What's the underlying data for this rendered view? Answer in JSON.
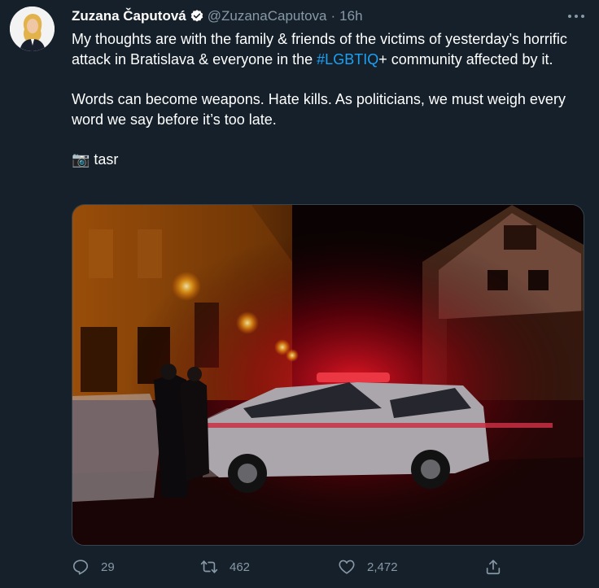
{
  "tweet": {
    "author_name": "Zuzana Čaputová",
    "handle": "@ZuzanaCaputova",
    "separator": "·",
    "time": "16h",
    "para1_before": "My thoughts are with the family & friends of the victims of yesterday’s horrific attack in Bratislava & everyone in the ",
    "hashtag": "#LGBTIQ",
    "para1_after": "+ community affected by it.",
    "para2": "Words can become weapons. Hate kills. As politicians, we must weigh every word we say before it’s too late.",
    "photo_credit": "📷 tasr"
  },
  "actions": {
    "reply_count": "29",
    "retweet_count": "462",
    "like_count": "2,472"
  },
  "colors": {
    "background": "#15202b",
    "secondary_text": "#8899a6",
    "accent": "#1da1f2"
  },
  "icons": [
    "verified-badge-icon",
    "more-icon",
    "reply-icon",
    "retweet-icon",
    "like-icon",
    "share-icon"
  ]
}
